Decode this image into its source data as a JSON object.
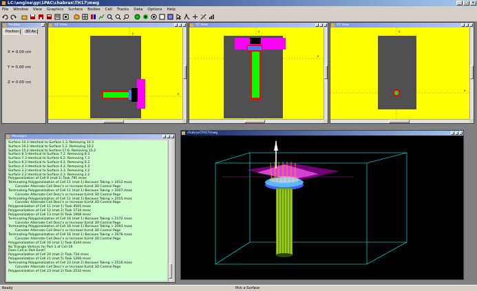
{
  "app": {
    "title": "LC:\\engine\\gp\\1PAC\\chabrax\\TH17\\mwg",
    "window_buttons": [
      "_",
      "□",
      "×"
    ]
  },
  "menu": [
    "File",
    "Window",
    "View",
    "Graphics",
    "Surface",
    "Bodies",
    "Cell",
    "Tracks",
    "Data",
    "Options",
    "Help"
  ],
  "status": {
    "left": "Ready",
    "center": "Pick a Surface"
  },
  "panels": {
    "position": {
      "title": "Position",
      "tab_position": "Position",
      "tab_3d": "3D Ax",
      "x_label": "X = 0.00 cm",
      "y_label": "Y = 0.00 cm",
      "z_label": "Z = 0.00 cm"
    },
    "view1": {
      "title": "XZ View"
    },
    "view2": {
      "title": "YZ View"
    },
    "view3": {
      "title": "XY View"
    },
    "log": {
      "title": "Messages",
      "lines": [
        {
          "t": "Surface 10.3 Identical to Surface 1.3.  Removing 10.3",
          "i": false
        },
        {
          "t": "Surface 10.2 Identical to Surface 1.2.  Removing 10.2",
          "i": false
        },
        {
          "t": "Surface 15.2 Identical to Surface 17.6.  Removing 15.2",
          "i": false
        },
        {
          "t": "Surface 8.3 Identical to Surface 7.2.  Removing 8.3",
          "i": false
        },
        {
          "t": "Surface 7.3 Identical to Surface 6.2.  Removing 7.3",
          "i": false
        },
        {
          "t": "Surface 6.3 Identical to Surface 6.2.  Removing 6.2",
          "i": false
        },
        {
          "t": "Surface 4.3 Identical to Surface 4.2.  Removing 4.3",
          "i": false
        },
        {
          "t": "Surface 3.2 Identical to Surface 3.3.  Removing 3.2",
          "i": false
        },
        {
          "t": "Surface 2.2 Identical to Surface 2.3.  Removing 2.2",
          "i": false
        },
        {
          "t": "Polygonalization of Cell 8 (mat 1) Took 795 msec",
          "i": false
        },
        {
          "t": "Terminating Polygonalization of Cell 11 (mat 1) Because Taking > 2012 msec",
          "i": false
        },
        {
          "t": "Consider Alternate Cell Desc'n or Increase tLimit 3D Control Page",
          "i": true
        },
        {
          "t": "Terminating Polygonalization of Cell 11 (mat 1) Because Taking > 2007 msec",
          "i": false
        },
        {
          "t": "Consider Alternate Cell Desc'n or Increase tLimit 3D Control Page",
          "i": true
        },
        {
          "t": "Terminating Polygonalization of Cell 11 (mat 1) Because Taking > 2015 msec",
          "i": false
        },
        {
          "t": "Consider Alternate Cell Desc'n or Increase tLimit 3D Control Page",
          "i": true
        },
        {
          "t": "Polygonalization of Cell 11 (mat 1) Took 4505 msec",
          "i": false
        },
        {
          "t": "Polygonalization of Cell 12 (mat 2) Took 1734 msec",
          "i": false
        },
        {
          "t": "Polygonalization of Cell 13 (mat 0) Took 1968 msec",
          "i": false
        },
        {
          "t": "Terminating Polygonalization of Cell 16 (mat 1) Because Taking > 2172 msec",
          "i": false
        },
        {
          "t": "Consider Alternate Cell Desc'n or Increase tLimit 3D Control Page",
          "i": true
        },
        {
          "t": "Terminating Polygonalization of Cell 16 (mat 1) Because Taking > 2093 msec",
          "i": false
        },
        {
          "t": "Consider Alternate Cell Desc'n or Increase tLimit 3D Control Page",
          "i": true
        },
        {
          "t": "Terminating Polygonalization of Cell 16 (mat 1) Because Taking > 2078 msec",
          "i": false
        },
        {
          "t": "Consider Alternate Cell Desc'n or Increase tLimit 3D Control Page",
          "i": true
        },
        {
          "t": "Polygonalization of Cell 16 (mat 1) Took 6344 msec",
          "i": false
        },
        {
          "t": "No Triangle Vertices for Part 1 of Cell 19",
          "i": false
        },
        {
          "t": "Does Cell or Part Exist?",
          "i": false
        },
        {
          "t": "Polygonalization of Cell 20 (mat 2) Took 734 msec",
          "i": false
        },
        {
          "t": "Polygonalization of Cell 21 (mat 5) Took 1266 msec",
          "i": false
        },
        {
          "t": "Terminating Polygonalization of Cell 23 (mat 2) Because Taking > 2516 msec",
          "i": false
        },
        {
          "t": "Consider Alternate Cell Desc'n or Increase tLimit 3D Control Page",
          "i": true
        },
        {
          "t": "Polygonalization of Cell 23 (mat 2) Took 2532 msec",
          "i": false
        }
      ]
    },
    "view3d": {
      "title": "chabrax\\TH17\\mwg"
    }
  },
  "toolbar": [
    "undo-icon",
    "redo-icon",
    "open-icon",
    "save-icon",
    "print-icon",
    "cut-icon",
    "copy-icon",
    "paste-icon",
    "cube-icon",
    "grid-icon",
    "layers-icon",
    "plot-icon",
    "zoom-in-icon",
    "zoom-out-icon",
    "zoom-box-icon",
    "sphere-icon",
    "target-icon",
    "ring-icon",
    "square-icon",
    "settings-icon",
    "pointer-icon",
    "rotate-icon",
    "pan-icon",
    "measure-icon",
    "bar-chart-icon"
  ],
  "colors": {
    "yellow_bg": "#ffff00",
    "gray_body": "#505050",
    "green": "#00ff00",
    "red": "#ff0000",
    "magenta": "#ff00ff",
    "blue": "#0000ff",
    "log_bg": "#ccffcc",
    "cyan": "#00c8c8"
  }
}
